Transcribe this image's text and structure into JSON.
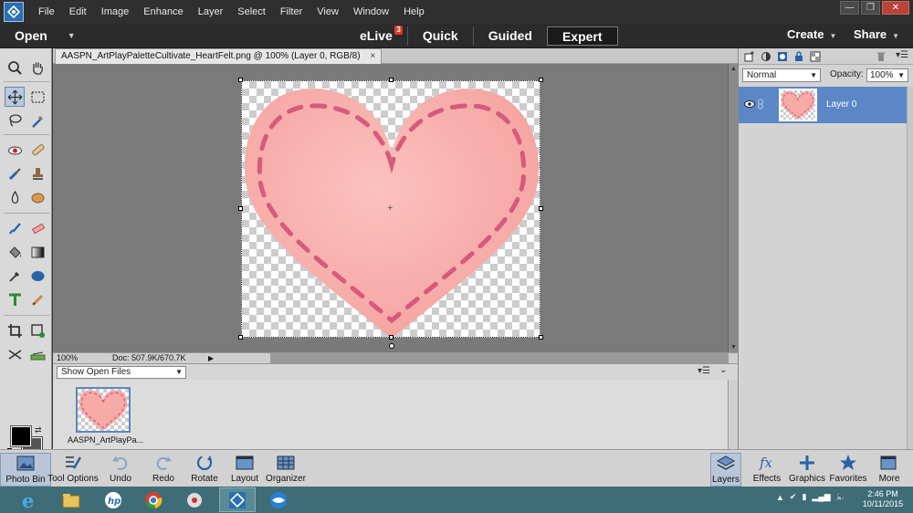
{
  "menu": [
    "File",
    "Edit",
    "Image",
    "Enhance",
    "Layer",
    "Select",
    "Filter",
    "View",
    "Window",
    "Help"
  ],
  "window_controls": {
    "minimize": "—",
    "restore": "❐",
    "close": "✕"
  },
  "modebar": {
    "open_label": "Open",
    "tabs": [
      {
        "label": "eLive",
        "badge": "3"
      },
      {
        "label": "Quick"
      },
      {
        "label": "Guided"
      },
      {
        "label": "Expert"
      }
    ],
    "create_label": "Create",
    "share_label": "Share"
  },
  "document": {
    "tab_title": "AASPN_ArtPlayPaletteCultivate_HeartFelt.png @ 100% (Layer 0, RGB/8)",
    "tab_close": "×",
    "zoom": "100%",
    "doc_size": "Doc: 507.9K/670.7K"
  },
  "photo_bin": {
    "select_value": "Show Open Files",
    "thumb_label": "AASPN_ArtPlayPa..."
  },
  "layers_panel": {
    "blend_mode": "Normal",
    "opacity_label": "Opacity:",
    "opacity_value": "100%",
    "layer_name": "Layer 0"
  },
  "taskbar_buttons": [
    "Photo Bin",
    "Tool Options",
    "Undo",
    "Redo",
    "Rotate",
    "Layout",
    "Organizer"
  ],
  "panel_buttons": [
    "Layers",
    "Effects",
    "Graphics",
    "Favorites",
    "More"
  ],
  "clock": {
    "time": "2:46 PM",
    "date": "10/11/2015"
  },
  "colors": {
    "accent": "#5b87c7",
    "heart": "#f8b3b0",
    "stitch": "#d65a7c"
  }
}
